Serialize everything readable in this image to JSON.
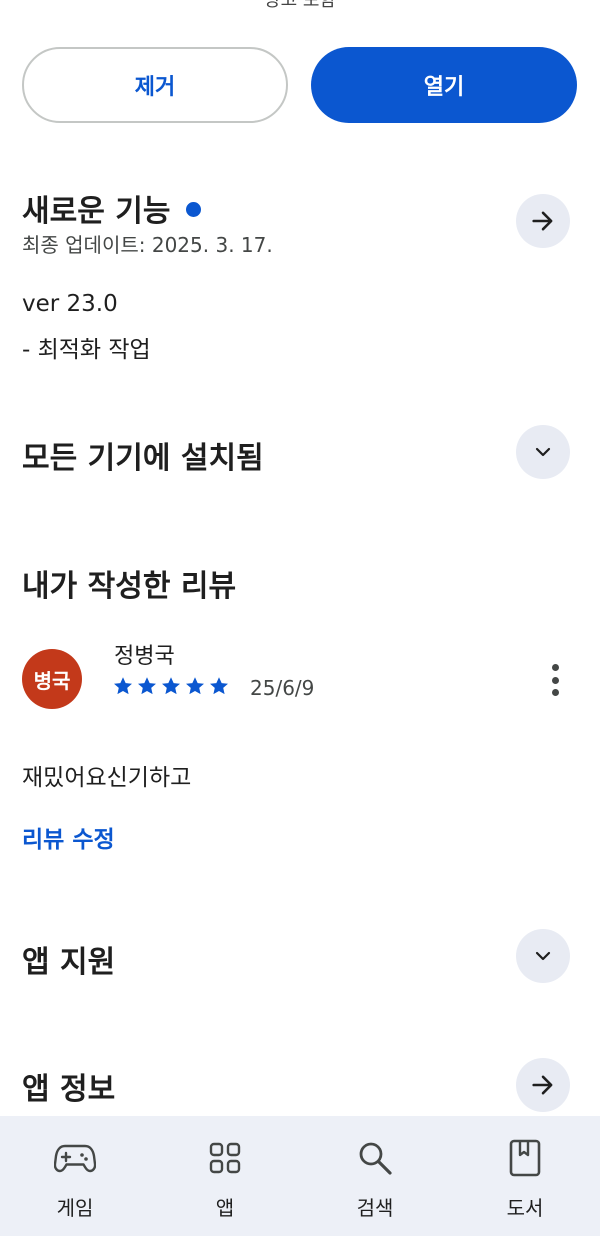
{
  "top_partial_text": "광고 포함",
  "actions": {
    "remove_label": "제거",
    "open_label": "열기"
  },
  "whats_new": {
    "title": "새로운 기능",
    "updated": "최종 업데이트: 2025. 3. 17.",
    "version": "ver 23.0",
    "note": "- 최적화 작업"
  },
  "installed": {
    "title": "모든 기기에 설치됨"
  },
  "my_review": {
    "title": "내가 작성한 리뷰",
    "avatar_text": "병국",
    "reviewer_name": "정병국",
    "rating": 5,
    "date": "25/6/9",
    "body": "재밌어요신기하고",
    "edit_label": "리뷰 수정"
  },
  "app_support": {
    "title": "앱 지원"
  },
  "app_info": {
    "title": "앱 정보"
  },
  "bottom_nav": {
    "games": "게임",
    "apps": "앱",
    "search": "검색",
    "books": "도서"
  },
  "colors": {
    "accent": "#0b57d0",
    "avatar": "#c3391a",
    "nav_bg": "#edf0f7"
  }
}
